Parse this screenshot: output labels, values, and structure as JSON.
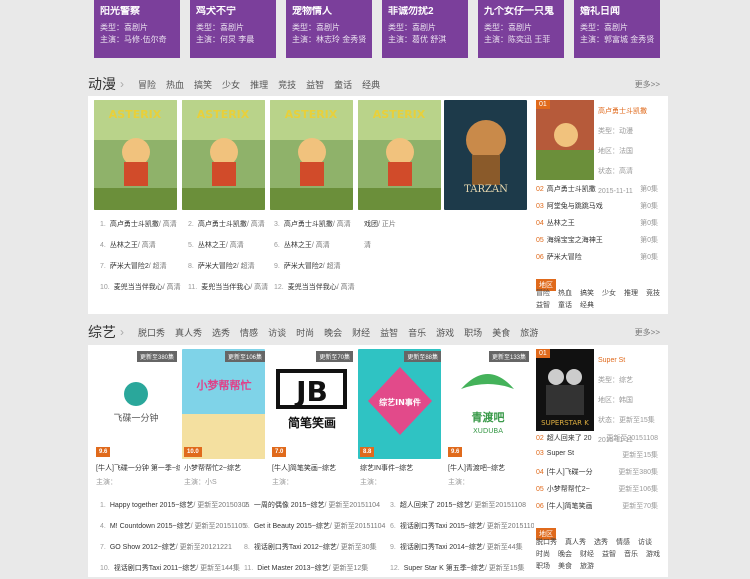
{
  "top_cards": [
    {
      "title": "阳光警察",
      "type": "类型：喜剧片",
      "cast": "主演：马修·伍尔奇"
    },
    {
      "title": "鸡犬不宁",
      "type": "类型：喜剧片",
      "cast": "主演：何炅 李晨"
    },
    {
      "title": "宠物情人",
      "type": "类型：喜剧片",
      "cast": "主演：林志玲 金秀贤"
    },
    {
      "title": "非诚勿扰2",
      "type": "类型：喜剧片",
      "cast": "主演：葛优 舒淇"
    },
    {
      "title": "九个女仔一只鬼",
      "type": "类型：喜剧片",
      "cast": "主演：陈奕迅 王菲"
    },
    {
      "title": "婚礼日闻",
      "type": "类型：喜剧片",
      "cast": "主演：郭富城 金秀贤"
    }
  ],
  "anime": {
    "name": "动漫",
    "tags": [
      "冒险",
      "热血",
      "搞笑",
      "少女",
      "推理",
      "竞技",
      "益智",
      "童话",
      "经典"
    ],
    "more": "更多>>",
    "col1": [
      {
        "num": "1.",
        "title": "高卢勇士斗凯撒",
        "sub": "/ 高清"
      },
      {
        "num": "4.",
        "title": "丛林之王",
        "sub": "/ 高清"
      },
      {
        "num": "7.",
        "title": "萨米大冒险2",
        "sub": "/ 超清"
      },
      {
        "num": "10.",
        "title": "麦兜当当伴我心",
        "sub": "/ 高清"
      }
    ],
    "col2": [
      {
        "num": "2.",
        "title": "高卢勇士斗凯撒",
        "sub": "/ 高清"
      },
      {
        "num": "5.",
        "title": "丛林之王",
        "sub": "/ 高清"
      },
      {
        "num": "8.",
        "title": "萨米大冒险2",
        "sub": "/ 超清"
      },
      {
        "num": "11.",
        "title": "麦兜当当伴我心",
        "sub": "/ 高清"
      }
    ],
    "col3": [
      {
        "num": "3.",
        "title": "高卢勇士斗凯撒",
        "sub": "/ 高清"
      },
      {
        "num": "6.",
        "title": "丛林之王",
        "sub": "/ 高清"
      },
      {
        "num": "9.",
        "title": "萨米大冒险2",
        "sub": "/ 超清"
      },
      {
        "num": "12.",
        "title": "麦兜当当伴我心",
        "sub": "/ 高清"
      }
    ],
    "col4": [
      {
        "num": "",
        "title": "戏团",
        "sub": "/ 正片"
      },
      {
        "num": "",
        "title": "",
        "sub": "清"
      },
      {
        "num": "",
        "title": "",
        "sub": ""
      },
      {
        "num": "",
        "title": "",
        "sub": ""
      }
    ],
    "featured": {
      "rank": "01",
      "title": "高卢勇士斗凯撒",
      "type": "类型：动漫",
      "area": "地区：法国",
      "status": "状态：高清",
      "date": "2015-11-11"
    },
    "ranks": [
      {
        "n": "02",
        "title": "高卢勇士斗凯撒",
        "cnt": "第0集"
      },
      {
        "n": "03",
        "title": "阿堂兔与跳跳马戏",
        "cnt": "第0集"
      },
      {
        "n": "04",
        "title": "丛林之王",
        "cnt": "第0集"
      },
      {
        "n": "05",
        "title": "海绵宝宝之海神王",
        "cnt": "第0集"
      },
      {
        "n": "06",
        "title": "萨米大冒险",
        "cnt": "第0集"
      }
    ],
    "region_label": "地区",
    "side_tags": [
      "冒险",
      "热血",
      "搞笑",
      "少女",
      "推理",
      "竞技",
      "益智",
      "童话",
      "经典"
    ]
  },
  "variety": {
    "name": "综艺",
    "tags": [
      "脱口秀",
      "真人秀",
      "选秀",
      "情感",
      "访谈",
      "时尚",
      "晚会",
      "财经",
      "益智",
      "音乐",
      "游戏",
      "职场",
      "美食",
      "旅游"
    ],
    "more": "更多>>",
    "cards": [
      {
        "label": "更新至380集",
        "score": "9.6",
        "title": "[牛人]飞碟一分钟 第一季~综",
        "cast": "主演："
      },
      {
        "label": "更新至106集",
        "score": "10.0",
        "title": "小梦帮帮忙2~综艺",
        "cast": "主演：小S"
      },
      {
        "label": "更新至70集",
        "score": "7.0",
        "title": "[牛人]简笔笑画~综艺",
        "cast": "主演："
      },
      {
        "label": "更新至88集",
        "score": "8.8",
        "title": "综艺IN事件~综艺",
        "cast": "主演："
      },
      {
        "label": "更新至133集",
        "score": "9.6",
        "title": "[牛人]青渡吧~综艺",
        "cast": "主演："
      }
    ],
    "poster_texts": {
      "feiyi": "飞碟一分钟",
      "jb": "JB",
      "jb_sub": "简笔笑画",
      "xiaomeng": "小梦帮帮忙",
      "xudu": "青渡吧",
      "xudu_en": "XUDUBA",
      "zy": "综艺IN事件"
    },
    "col1": [
      {
        "num": "1.",
        "title": "Happy together 2015~综艺",
        "sub": "/ 更新至20150305"
      },
      {
        "num": "4.",
        "title": "M! Countdown 2015~综艺",
        "sub": "/ 更新至20151105"
      },
      {
        "num": "7.",
        "title": "GO Show 2012~综艺",
        "sub": "/ 更新至20121221"
      },
      {
        "num": "10.",
        "title": "视话剧口秀Taxi 2011~综艺",
        "sub": "/ 更新至144集"
      }
    ],
    "col2": [
      {
        "num": "2.",
        "title": "一周的偶像 2015~综艺",
        "sub": "/ 更新至20151104"
      },
      {
        "num": "5.",
        "title": "Get it Beauty 2015~综艺",
        "sub": "/ 更新至20151104"
      },
      {
        "num": "8.",
        "title": "视话剧口秀Taxi 2012~综艺",
        "sub": "/ 更新至30集"
      },
      {
        "num": "11.",
        "title": "Diet Master 2013~综艺",
        "sub": "/ 更新至12集"
      }
    ],
    "col3": [
      {
        "num": "3.",
        "title": "超人回来了 2015~综艺",
        "sub": "/ 更新至20151108"
      },
      {
        "num": "6.",
        "title": "视话剧口秀Taxi 2015~综艺",
        "sub": "/ 更新至20151103"
      },
      {
        "num": "9.",
        "title": "视话剧口秀Taxi 2014~综艺",
        "sub": "/ 更新至44集"
      },
      {
        "num": "12.",
        "title": "Super Star K 第五季~综艺",
        "sub": "/ 更新至15集"
      }
    ],
    "featured": {
      "rank": "01",
      "title": "Super St",
      "type": "类型：综艺",
      "area": "地区：韩国",
      "status": "状态：更新至15集",
      "date": "2015-11-11"
    },
    "ranks": [
      {
        "n": "02",
        "title": "超人回来了 20",
        "cnt": "更新至20151108"
      },
      {
        "n": "03",
        "title": "Super St",
        "cnt": "更新至15集"
      },
      {
        "n": "04",
        "title": "[牛人]飞碟一分",
        "cnt": "更新至380集"
      },
      {
        "n": "05",
        "title": "小梦帮帮忙2~",
        "cnt": "更新至106集"
      },
      {
        "n": "06",
        "title": "[牛人]简笔笑画",
        "cnt": "更新至70集"
      }
    ],
    "region_label": "地区",
    "side_tags": [
      "脱口秀",
      "真人秀",
      "选秀",
      "情感",
      "访谈",
      "时尚",
      "晚会",
      "财经",
      "益智",
      "音乐",
      "游戏",
      "职场",
      "美食",
      "旅游"
    ]
  }
}
